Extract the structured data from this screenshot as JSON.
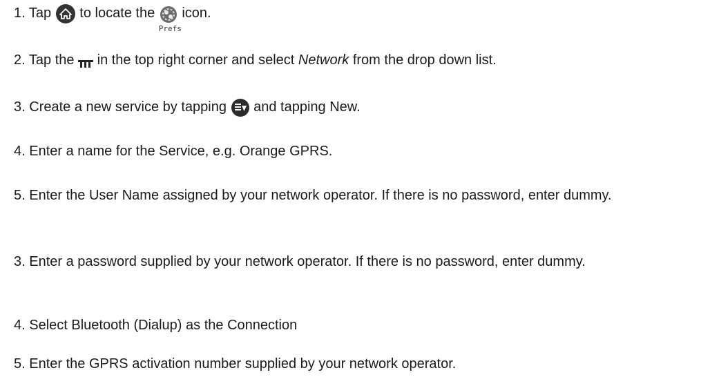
{
  "steps": {
    "s1": {
      "num": "1.",
      "part_a": "Tap",
      "part_b": "to locate the",
      "part_c": "icon.",
      "prefs_label": "Prefs"
    },
    "s2": {
      "num": "2.",
      "part_a": "Tap the",
      "part_b": "in the top right corner and select",
      "italic": "Network",
      "part_c": "from the drop down list."
    },
    "s3": {
      "num": "3.",
      "part_a": "Create  a new service by tapping",
      "part_b": "and tapping New."
    },
    "s4": {
      "text": "4. Enter a name for the Service, e.g. Orange GPRS."
    },
    "s5": {
      "text": "5. Enter the  User Name assigned by your network operator. If there is no password, enter dummy."
    },
    "s6": {
      "text": "3. Enter a password supplied by your network operator. If there is no password, enter dummy."
    },
    "s7": {
      "text": "4. Select Bluetooth (Dialup) as the Connection"
    },
    "s8": {
      "text": "5. Enter the GPRS activation number supplied by your network operator."
    }
  },
  "icons": {
    "home": "home-icon",
    "prefs": "prefs-icon",
    "menu": "menu-bar-icon",
    "service_menu": "service-menu-icon"
  }
}
